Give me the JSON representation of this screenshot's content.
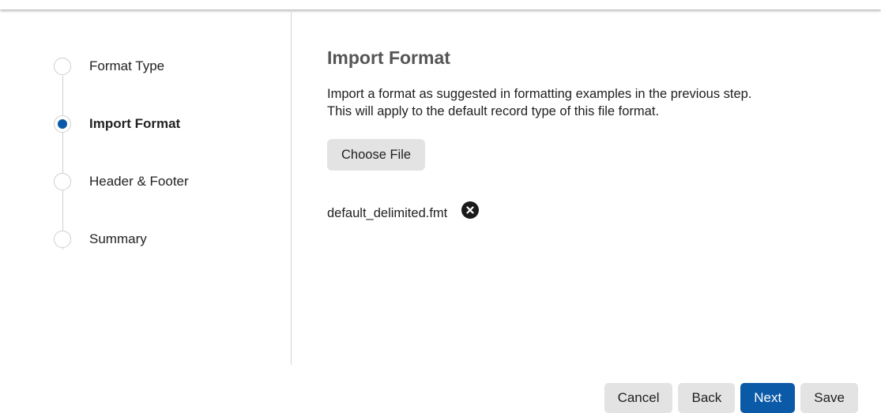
{
  "stepper": {
    "steps": [
      {
        "label": "Format Type",
        "state": "incomplete"
      },
      {
        "label": "Import Format",
        "state": "active"
      },
      {
        "label": "Header & Footer",
        "state": "incomplete"
      },
      {
        "label": "Summary",
        "state": "incomplete"
      }
    ]
  },
  "main": {
    "title": "Import Format",
    "description_line1": "Import a format as suggested in formatting examples in the previous step.",
    "description_line2": "This will apply to the default record type of this file format.",
    "choose_file_label": "Choose File",
    "selected_file": "default_delimited.fmt",
    "remove_file_icon": "close-circle-icon"
  },
  "footer": {
    "cancel_label": "Cancel",
    "back_label": "Back",
    "next_label": "Next",
    "save_label": "Save"
  },
  "colors": {
    "accent": "#0a5aa8",
    "secondary_button": "#e3e3e3",
    "title": "#555555"
  }
}
